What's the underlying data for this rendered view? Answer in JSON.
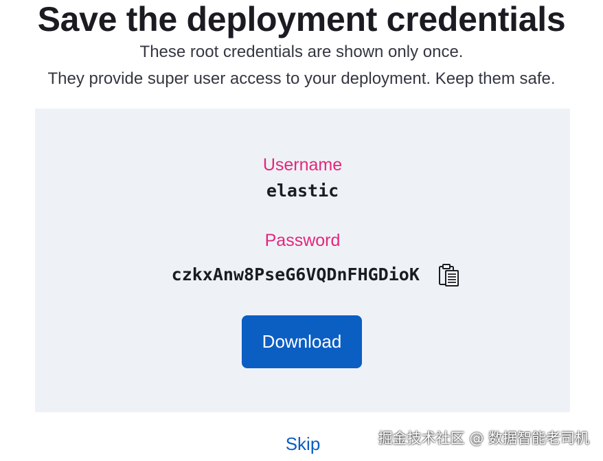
{
  "header": {
    "title": "Save the deployment credentials",
    "subtitle_line1": "These root credentials are shown only once.",
    "subtitle_line2": "They provide super user access to your deployment. Keep them safe."
  },
  "credentials": {
    "username_label": "Username",
    "username_value": "elastic",
    "password_label": "Password",
    "password_value": "czkxAnw8PseG6VQDnFHGDioK",
    "copy_icon": "clipboard-icon"
  },
  "actions": {
    "download_label": "Download",
    "skip_label": "Skip"
  },
  "watermark": {
    "text": "掘金技术社区 @ 数据智能老司机"
  },
  "colors": {
    "label_pink": "#e5267b",
    "button_blue": "#0b5ec2",
    "panel_bg": "#eef2f7",
    "title_text": "#1a1c21"
  }
}
